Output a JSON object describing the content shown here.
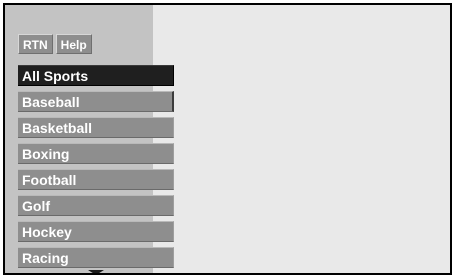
{
  "toolbar": {
    "buttons": [
      "RTN",
      "Help"
    ]
  },
  "menu": {
    "items": [
      {
        "label": "All Sports",
        "selected": true
      },
      {
        "label": "Baseball",
        "selected": false
      },
      {
        "label": "Basketball",
        "selected": false
      },
      {
        "label": "Boxing",
        "selected": false
      },
      {
        "label": "Football",
        "selected": false
      },
      {
        "label": "Golf",
        "selected": false
      },
      {
        "label": "Hockey",
        "selected": false
      },
      {
        "label": "Racing",
        "selected": false
      }
    ]
  },
  "icons": {
    "scroll_down": "arrow-down-icon"
  },
  "colors": {
    "frame_border": "#000000",
    "content_bg": "#e9e9e9",
    "sidebar_bg": "#c3c3c3",
    "item_bg": "#8e8e8e",
    "item_selected_bg": "#1f1f1f",
    "item_text": "#ffffff"
  }
}
